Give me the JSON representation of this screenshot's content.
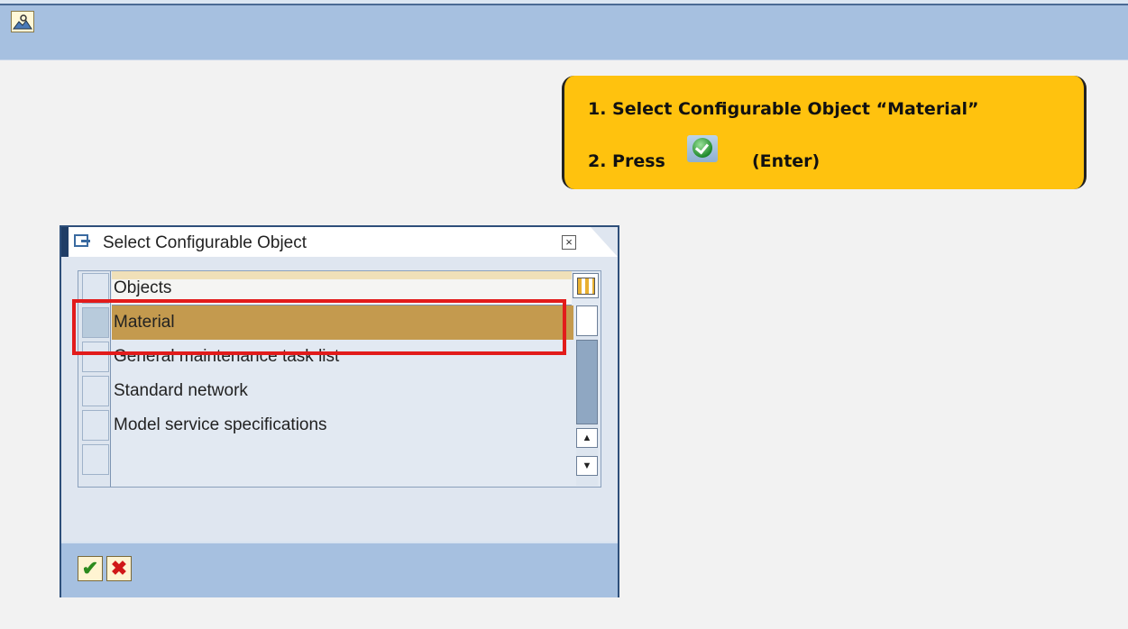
{
  "toolbar": {
    "icon": "picture-icon"
  },
  "callout": {
    "line1": "1. Select Configurable Object “Material”",
    "line2_prefix": "2. Press",
    "line2_suffix": "(Enter)",
    "icon": "enter-check-icon"
  },
  "dialog": {
    "title": "Select Configurable Object",
    "close_label": "×",
    "table": {
      "header": "Objects",
      "rows": [
        {
          "label": "Material",
          "selected": true
        },
        {
          "label": "General maintenance task list",
          "selected": false
        },
        {
          "label": "Standard network",
          "selected": false
        },
        {
          "label": "Model service specifications",
          "selected": false
        },
        {
          "label": "",
          "selected": false
        }
      ]
    },
    "scroll_up": "▲",
    "scroll_down": "▼",
    "buttons": {
      "ok": "✔",
      "cancel": "✖"
    }
  },
  "colors": {
    "callout": "#ffc20e",
    "highlight": "#e21b1b",
    "selected_row": "#c49a4e",
    "toolbar": "#a6c0e0"
  }
}
